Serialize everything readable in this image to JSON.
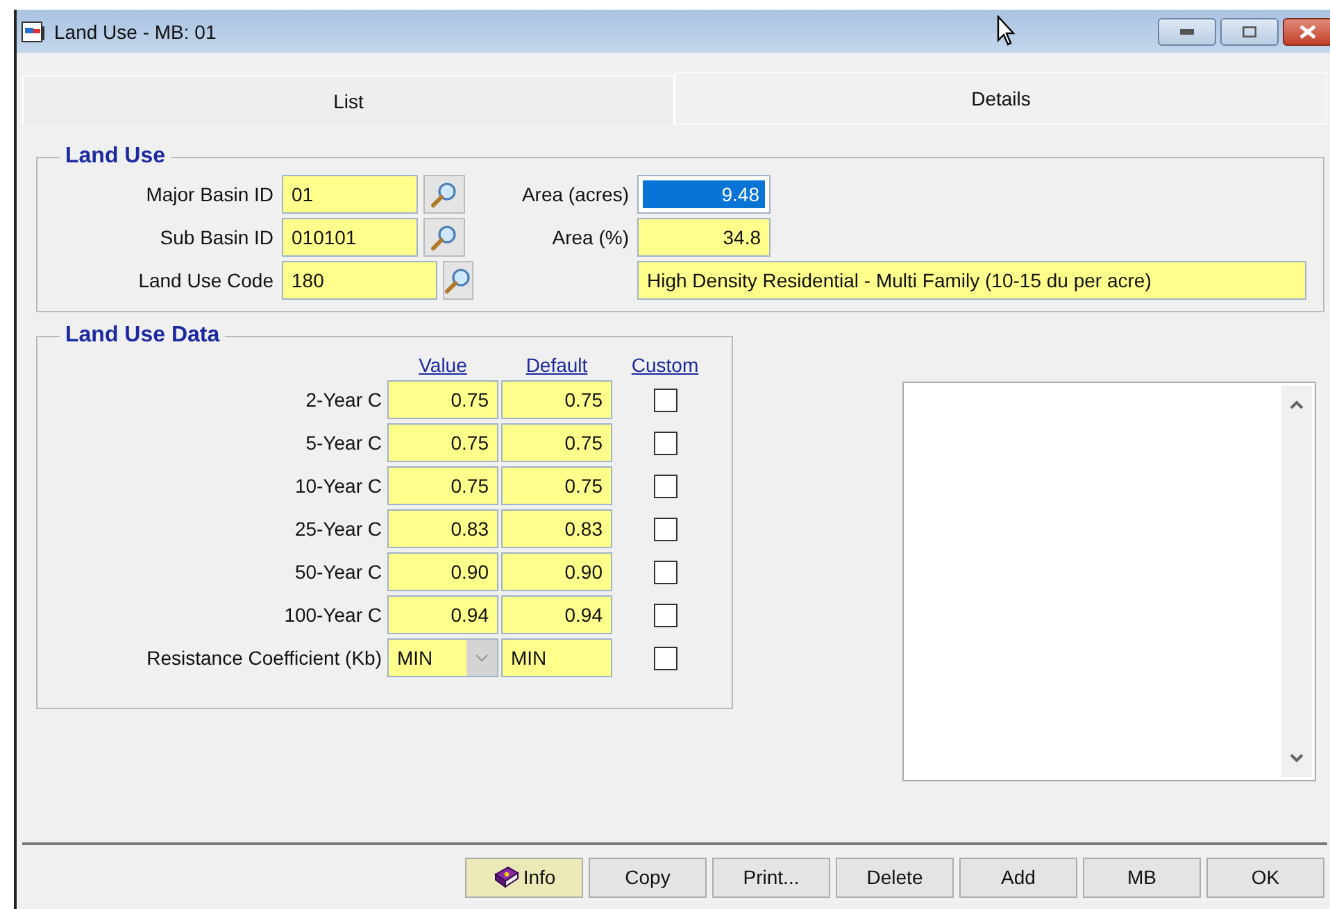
{
  "window": {
    "title": "Land Use - MB: 01"
  },
  "tabs": [
    {
      "label": "List",
      "selected": false
    },
    {
      "label": "Details",
      "selected": true
    }
  ],
  "land_use": {
    "title": "Land Use",
    "major_basin_id": {
      "label": "Major Basin ID",
      "value": "01"
    },
    "sub_basin_id": {
      "label": "Sub Basin ID",
      "value": "010101"
    },
    "land_use_code": {
      "label": "Land Use Code",
      "value": "180"
    },
    "area_acres": {
      "label": "Area (acres)",
      "value": "9.48",
      "selected": true
    },
    "area_percent": {
      "label": "Area (%)",
      "value": "34.8"
    },
    "description": {
      "value": "High Density Residential - Multi Family (10-15 du per acre)"
    }
  },
  "land_use_data": {
    "title": "Land Use Data",
    "columns": [
      "Value",
      "Default",
      "Custom"
    ],
    "rows": [
      {
        "kind": "number",
        "label": "2-Year C",
        "value": "0.75",
        "default": "0.75",
        "custom": false
      },
      {
        "kind": "number",
        "label": "5-Year C",
        "value": "0.75",
        "default": "0.75",
        "custom": false
      },
      {
        "kind": "number",
        "label": "10-Year C",
        "value": "0.75",
        "default": "0.75",
        "custom": false
      },
      {
        "kind": "number",
        "label": "25-Year C",
        "value": "0.83",
        "default": "0.83",
        "custom": false
      },
      {
        "kind": "number",
        "label": "50-Year C",
        "value": "0.90",
        "default": "0.90",
        "custom": false
      },
      {
        "kind": "number",
        "label": "100-Year C",
        "value": "0.94",
        "default": "0.94",
        "custom": false
      },
      {
        "kind": "dropdown",
        "label": "Resistance Coefficient (Kb)",
        "value": "MIN",
        "default": "MIN",
        "custom": false
      }
    ]
  },
  "buttons": [
    {
      "label": "Info",
      "focused": true
    },
    {
      "label": "Copy",
      "focused": false
    },
    {
      "label": "Print...",
      "focused": false
    },
    {
      "label": "Delete",
      "focused": false
    },
    {
      "label": "Add",
      "focused": false
    },
    {
      "label": "MB",
      "focused": false
    },
    {
      "label": "OK",
      "focused": false
    }
  ]
}
